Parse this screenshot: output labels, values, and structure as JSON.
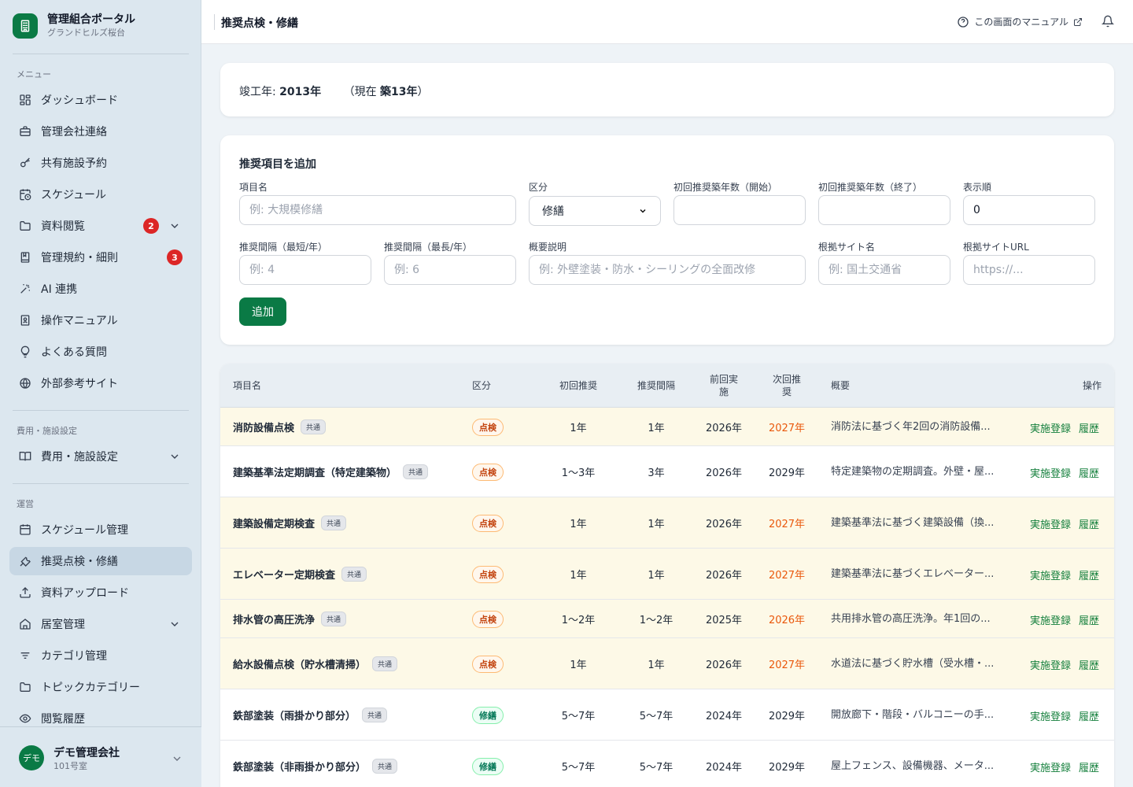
{
  "brand": {
    "title": "管理組合ポータル",
    "subtitle": "グランドヒルズ桜台"
  },
  "sidebar": {
    "section_menu": "メニュー",
    "menu": [
      {
        "label": "ダッシュボード",
        "icon": "dashboard-icon"
      },
      {
        "label": "管理会社連絡",
        "icon": "briefcase-icon"
      },
      {
        "label": "共有施設予約",
        "icon": "key-icon"
      },
      {
        "label": "スケジュール",
        "icon": "calendar-clock-icon"
      },
      {
        "label": "資料閲覧",
        "icon": "folder-icon",
        "badge": "2"
      },
      {
        "label": "管理規約・細則",
        "icon": "bookmark-book-icon",
        "badge": "3"
      },
      {
        "label": "AI 連携",
        "icon": "sparkles-icon"
      },
      {
        "label": "操作マニュアル",
        "icon": "manual-icon"
      },
      {
        "label": "よくある質問",
        "icon": "lightbulb-icon"
      },
      {
        "label": "外部参考サイト",
        "icon": "globe-icon"
      }
    ],
    "section_cost": "費用・施設設定",
    "cost_item": {
      "label": "費用・施設設定",
      "icon": "book-open-icon"
    },
    "section_ops": "運営",
    "ops": [
      {
        "label": "スケジュール管理",
        "icon": "calendar-icon"
      },
      {
        "label": "推奨点検・修繕",
        "icon": "wrench-icon"
      },
      {
        "label": "資料アップロード",
        "icon": "upload-icon"
      },
      {
        "label": "居室管理",
        "icon": "home-icon"
      },
      {
        "label": "カテゴリ管理",
        "icon": "filter-icon"
      },
      {
        "label": "トピックカテゴリー",
        "icon": "folder-icon"
      },
      {
        "label": "閲覧履歴",
        "icon": "eye-icon"
      }
    ]
  },
  "user": {
    "avatar": "デモ",
    "name": "デモ管理会社",
    "room": "101号室"
  },
  "header": {
    "title": "推奨点検・修繕",
    "manual_link": "この画面のマニュアル"
  },
  "building": {
    "built_label": "竣工年:",
    "built_year": "2013年",
    "now_prefix": "（現在",
    "age": "築13年",
    "now_suffix": "）"
  },
  "form": {
    "title": "推奨項目を追加",
    "item_name_label": "項目名",
    "item_name_placeholder": "例: 大規模修繕",
    "kind_label": "区分",
    "kind_value": "修繕",
    "first_start_label": "初回推奨築年数（開始）",
    "first_end_label": "初回推奨築年数（終了）",
    "order_label": "表示順",
    "order_value": "0",
    "interval_min_label": "推奨間隔（最短/年）",
    "interval_min_placeholder": "例: 4",
    "interval_max_label": "推奨間隔（最長/年）",
    "interval_max_placeholder": "例: 6",
    "summary_label": "概要説明",
    "summary_placeholder": "例: 外壁塗装・防水・シーリングの全面改修",
    "source_name_label": "根拠サイト名",
    "source_name_placeholder": "例: 国土交通省",
    "source_url_label": "根拠サイトURL",
    "source_url_placeholder": "https://...",
    "add_button": "追加"
  },
  "table": {
    "headers": {
      "name": "項目名",
      "kind": "区分",
      "first": "初回推奨",
      "interval": "推奨間隔",
      "last": "前回実施",
      "next": "次回推奨",
      "summary": "概要",
      "actions": "操作"
    },
    "common_tag": "共通",
    "action_register": "実施登録",
    "action_history": "履歴",
    "rows": [
      {
        "name": "消防設備点検",
        "kind": "点検",
        "first": "1年",
        "interval": "1年",
        "last": "2026年",
        "next": "2027年",
        "next_warn": true,
        "summary": "消防法に基づく年2回の消防設備...",
        "highlight": true
      },
      {
        "name": "建築基準法定期調査（特定建築物）",
        "kind": "点検",
        "first": "1〜3年",
        "interval": "3年",
        "last": "2026年",
        "next": "2029年",
        "next_warn": false,
        "summary": "特定建築物の定期調査。外壁・屋...",
        "highlight": false
      },
      {
        "name": "建築設備定期検査",
        "kind": "点検",
        "first": "1年",
        "interval": "1年",
        "last": "2026年",
        "next": "2027年",
        "next_warn": true,
        "summary": "建築基準法に基づく建築設備（換...",
        "highlight": true
      },
      {
        "name": "エレベーター定期検査",
        "kind": "点検",
        "first": "1年",
        "interval": "1年",
        "last": "2026年",
        "next": "2027年",
        "next_warn": true,
        "summary": "建築基準法に基づくエレベーター...",
        "highlight": true
      },
      {
        "name": "排水管の高圧洗浄",
        "kind": "点検",
        "first": "1〜2年",
        "interval": "1〜2年",
        "last": "2025年",
        "next": "2026年",
        "next_warn": true,
        "summary": "共用排水管の高圧洗浄。年1回の...",
        "highlight": true
      },
      {
        "name": "給水設備点検（貯水槽清掃）",
        "kind": "点検",
        "first": "1年",
        "interval": "1年",
        "last": "2026年",
        "next": "2027年",
        "next_warn": true,
        "summary": "水道法に基づく貯水槽（受水槽・...",
        "highlight": true
      },
      {
        "name": "鉄部塗装（雨掛かり部分）",
        "kind": "修繕",
        "first": "5〜7年",
        "interval": "5〜7年",
        "last": "2024年",
        "next": "2029年",
        "next_warn": false,
        "summary": "開放廊下・階段・バルコニーの手...",
        "highlight": false
      },
      {
        "name": "鉄部塗装（非雨掛かり部分）",
        "kind": "修繕",
        "first": "5〜7年",
        "interval": "5〜7年",
        "last": "2024年",
        "next": "2029年",
        "next_warn": false,
        "summary": "屋上フェンス、設備機器、メータ...",
        "highlight": false
      }
    ]
  },
  "colors": {
    "accent": "#0a7a45",
    "warn": "#ea580c",
    "badge": "#dc2626",
    "sidebar_bg": "#dce7ef"
  }
}
